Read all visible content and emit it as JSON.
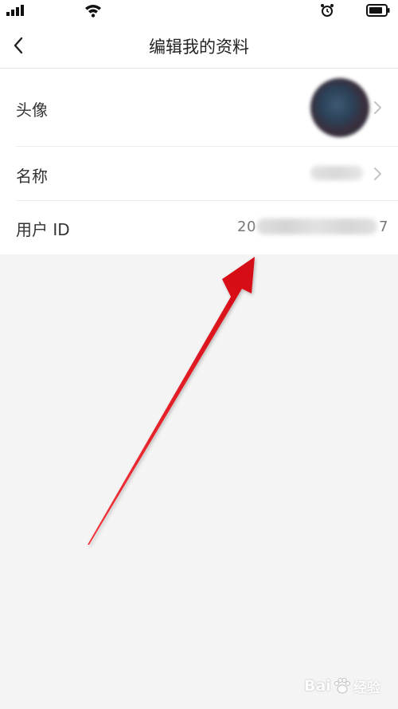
{
  "nav": {
    "title": "编辑我的资料",
    "back_icon": "chevron-left-icon"
  },
  "profile": {
    "rows": [
      {
        "label": "头像",
        "value_type": "avatar"
      },
      {
        "label": "名称",
        "value_type": "blurred-text"
      },
      {
        "label": "用户 ID",
        "id_prefix": "20",
        "id_suffix": "7"
      }
    ]
  },
  "watermark": {
    "text_latin": "Bai",
    "text_cn": "经验"
  },
  "colors": {
    "background": "#f4f4f4",
    "card": "#ffffff",
    "arrow": "#e8141c"
  }
}
